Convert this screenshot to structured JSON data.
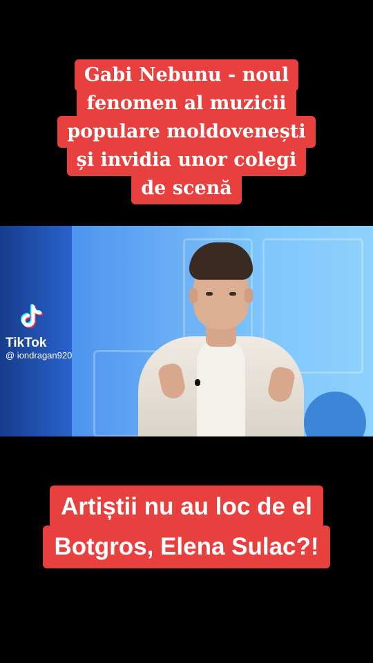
{
  "top_caption": {
    "lines": [
      "Gabi Nebunu - noul",
      "fenomen al muzicii",
      "populare moldovenești",
      "și invidia unor colegi",
      "de scenă"
    ],
    "bg_color": "#e8403f"
  },
  "video": {
    "icons": [
      "tiktok-logo-icon"
    ]
  },
  "watermark": {
    "brand": "TikTok",
    "handle": "@ iondragan920"
  },
  "bottom_caption": {
    "lines": [
      "Artiștii nu au loc de el",
      "Botgros, Elena Sulac?!"
    ],
    "bg_color": "#e8403f"
  }
}
